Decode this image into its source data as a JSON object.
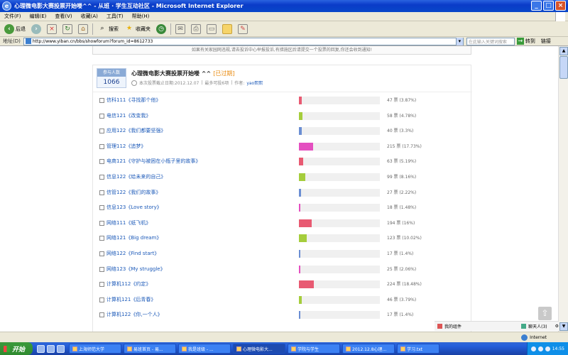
{
  "window": {
    "title": "心理微电影大赛投票开始喽^^ - 从班 · 学生互动社区 - Microsoft Internet Explorer"
  },
  "menu": [
    "文件(F)",
    "编辑(E)",
    "查看(V)",
    "收藏(A)",
    "工具(T)",
    "帮助(H)"
  ],
  "toolbar": {
    "back": "后退",
    "search": "搜索",
    "favorites": "收藏夹"
  },
  "address": {
    "label": "地址(D)",
    "url": "http://www.yiban.cn/bbs/showforum?forum_id=8612733",
    "search_placeholder": "在此输入关键词搜索",
    "go": "转到",
    "links": "链接"
  },
  "notice": "如果有关家园网违规,请去投诉中心举报投诉,有措施区后请提交一个投票的回复,你还会收到通知!",
  "poll": {
    "count_label": "参与人数",
    "count": "1066",
    "title": "心理微电影大赛投票开始喽 ^^",
    "status": "[已过期]",
    "deadline": "本次投票截止日期:2012.12.07",
    "max": "最多可投6项",
    "author_label": "作者:",
    "author": "yao熙熙",
    "options": [
      {
        "name": "信科111《寻找那个他》",
        "stat": "47 票 (3.87%)",
        "pct": 3.87,
        "color": "#e85a72"
      },
      {
        "name": "电信121《改变我》",
        "stat": "58 票 (4.78%)",
        "pct": 4.78,
        "color": "#a5cd3c"
      },
      {
        "name": "应用122《我们都要坚强》",
        "stat": "40 票 (3.3%)",
        "pct": 3.3,
        "color": "#6b8ed3"
      },
      {
        "name": "管理112《追梦》",
        "stat": "215 票 (17.73%)",
        "pct": 17.73,
        "color": "#e44fc0"
      },
      {
        "name": "电商121《守护与被困在小瓶子里的故事》",
        "stat": "63 票 (5.19%)",
        "pct": 5.19,
        "color": "#e85a72"
      },
      {
        "name": "信息122《给未来的自己》",
        "stat": "99 票 (8.16%)",
        "pct": 8.16,
        "color": "#a5cd3c"
      },
      {
        "name": "信管122《我们的故事》",
        "stat": "27 票 (2.22%)",
        "pct": 2.22,
        "color": "#6b8ed3"
      },
      {
        "name": "信息123《Love story》",
        "stat": "18 票 (1.48%)",
        "pct": 1.48,
        "color": "#e44fc0"
      },
      {
        "name": "网络111《纸飞机》",
        "stat": "194 票 (16%)",
        "pct": 16,
        "color": "#e85a72"
      },
      {
        "name": "网络121《Big dream》",
        "stat": "123 票 (10.02%)",
        "pct": 10.02,
        "color": "#a5cd3c"
      },
      {
        "name": "网络122《Find start》",
        "stat": "17 票 (1.4%)",
        "pct": 1.4,
        "color": "#6b8ed3"
      },
      {
        "name": "网络123《My struggle》",
        "stat": "25 票 (2.06%)",
        "pct": 2.06,
        "color": "#e44fc0"
      },
      {
        "name": "计算机112《约定》",
        "stat": "224 票 (18.48%)",
        "pct": 18.48,
        "color": "#e85a72"
      },
      {
        "name": "计算机121《后青春》",
        "stat": "46 票 (3.79%)",
        "pct": 3.79,
        "color": "#a5cd3c"
      },
      {
        "name": "计算机122《你,一个人》",
        "stat": "17 票 (1.4%)",
        "pct": 1.4,
        "color": "#6b8ed3"
      }
    ]
  },
  "follow": {
    "label": "我的组件",
    "friends": "聊天人(3)"
  },
  "status": {
    "zone": "Internet"
  },
  "taskbar": {
    "start": "开始",
    "tasks": [
      "上海师范大学",
      "易班首页 - 易...",
      "我是班级 - ...",
      "心理微电影大...",
      "学院与学生",
      "2012.12.8心理...",
      "学习.txt"
    ],
    "clock": "14:55"
  }
}
